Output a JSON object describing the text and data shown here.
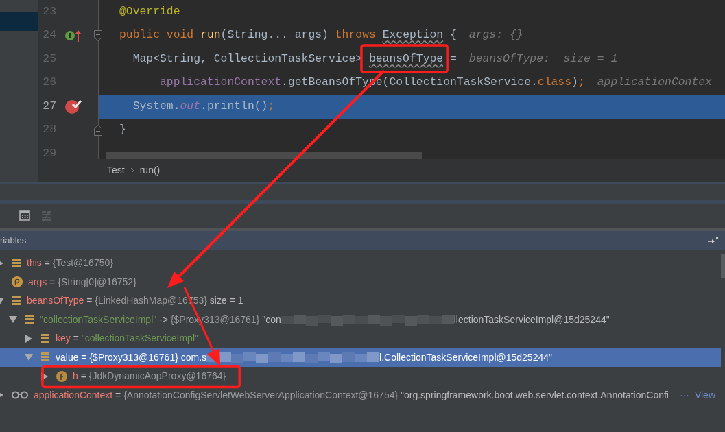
{
  "project_panel": {
    "items": [
      {
        "selected": true
      }
    ]
  },
  "editor": {
    "lines": [
      {
        "number": "23",
        "current": false,
        "tokens": [
          {
            "text": "@Override",
            "kind": "annotation"
          }
        ]
      },
      {
        "number": "24",
        "current": false,
        "marker": {
          "kind": "implements"
        },
        "fold": {
          "kind": "start"
        },
        "tokens": [
          {
            "text": "public void",
            "kind": "keyword"
          },
          {
            "text": " run",
            "kind": "method"
          },
          {
            "text": "(String... args) ",
            "kind": "plain"
          },
          {
            "text": "throws ",
            "kind": "keyword"
          },
          {
            "text": "Exception",
            "kind": "warning"
          },
          {
            "text": " {",
            "kind": "plain"
          }
        ],
        "hint": "args: {}"
      },
      {
        "number": "25",
        "current": false,
        "tokens": [
          {
            "text": "  Map<String, CollectionTaskService> ",
            "kind": "plain"
          },
          {
            "text": "beansOfType",
            "kind": "warning",
            "highlighted": true
          },
          {
            "text": " =",
            "kind": "plain"
          }
        ],
        "hint": "beansOfType:  size = 1"
      },
      {
        "number": "26",
        "current": false,
        "tokens": [
          {
            "text": "      applicationContext",
            "kind": "field"
          },
          {
            "text": ".getBeansOfType(CollectionTaskService.",
            "kind": "plain"
          },
          {
            "text": "class",
            "kind": "keyword"
          },
          {
            "text": ")",
            "kind": "plain"
          },
          {
            "text": ";",
            "kind": "keyword"
          }
        ],
        "hint": "applicationContex"
      },
      {
        "number": "27",
        "current": true,
        "marker": {
          "kind": "breakpoint"
        },
        "tokens": [
          {
            "text": "  System.",
            "kind": "plain"
          },
          {
            "text": "out",
            "kind": "static"
          },
          {
            "text": ".println()",
            "kind": "plain"
          },
          {
            "text": ";",
            "kind": "keyword"
          }
        ]
      },
      {
        "number": "28",
        "current": false,
        "fold": {
          "kind": "end"
        },
        "tokens": [
          {
            "text": "}",
            "kind": "plain"
          }
        ]
      },
      {
        "number": "29",
        "current": false
      }
    ]
  },
  "breadcrumbs": [
    "Test",
    "run()"
  ],
  "debug_toolbar": {
    "buttons": [
      {
        "kind": "table",
        "disabled": false
      },
      {
        "kind": "compact",
        "disabled": true
      }
    ]
  },
  "variables": {
    "title": "riables",
    "tree": [
      {
        "kind": "object",
        "name": "this",
        "expanded": false,
        "selected": false,
        "parts": [
          {
            "kind": "plain",
            "text": "="
          },
          {
            "kind": "ref",
            "text": "{Test@16750}"
          }
        ]
      },
      {
        "kind": "parameter",
        "name": "args",
        "selected": false,
        "parts": [
          {
            "kind": "plain",
            "text": "="
          },
          {
            "kind": "ref",
            "text": "{String[0]@16752}"
          }
        ]
      },
      {
        "kind": "object",
        "name": "beansOfType",
        "expanded": true,
        "selected": false,
        "parts": [
          {
            "kind": "plain",
            "text": "="
          },
          {
            "kind": "ref",
            "text": "{LinkedHashMap@16753}"
          },
          {
            "kind": "plain",
            "text": " size = 1"
          }
        ],
        "children": [
          {
            "kind": "entry",
            "name": "\"collectionTaskServiceImpl\"",
            "expanded": true,
            "selected": false,
            "parts": [
              {
                "kind": "plain",
                "text": "->"
              },
              {
                "kind": "ref",
                "text": "{$Proxy313@16761}"
              },
              {
                "kind": "plain",
                "text": "\"con"
              },
              {
                "kind": "redacted"
              },
              {
                "kind": "plain",
                "text": "llectionTaskServiceImpl@15d25244\""
              }
            ],
            "children": [
              {
                "kind": "object",
                "name": "key",
                "expanded": false,
                "selected": false,
                "parts": [
                  {
                    "kind": "plain",
                    "text": "="
                  },
                  {
                    "kind": "string",
                    "text": "\"collectionTaskServiceImpl\""
                  }
                ]
              },
              {
                "kind": "object",
                "name": "value",
                "expanded": true,
                "selected": true,
                "parts": [
                  {
                    "kind": "plain",
                    "text": "="
                  },
                  {
                    "kind": "ref",
                    "text": "{$Proxy313@16761}"
                  },
                  {
                    "kind": "plain",
                    "text": "com.s"
                  },
                  {
                    "kind": "redacted"
                  },
                  {
                    "kind": "plain",
                    "text": "l.CollectionTaskServiceImpl@15d25244\""
                  }
                ],
                "children": [
                  {
                    "kind": "field",
                    "name": "h",
                    "expanded": false,
                    "selected": false,
                    "highlighted": true,
                    "parts": [
                      {
                        "kind": "plain",
                        "text": "="
                      },
                      {
                        "kind": "ref",
                        "text": "{JdkDynamicAopProxy@16764}"
                      }
                    ]
                  }
                ]
              }
            ]
          }
        ]
      },
      {
        "kind": "watch",
        "name": "applicationContext",
        "expanded": false,
        "selected": false,
        "parts": [
          {
            "kind": "plain",
            "text": "="
          },
          {
            "kind": "ref",
            "text": "{AnnotationConfigServletWebServerApplicationContext@16754}"
          },
          {
            "kind": "plain",
            "text": "\"org.springframework.boot.web.servlet.context.AnnotationConfi"
          },
          {
            "kind": "ellipsis",
            "text": "···"
          },
          {
            "kind": "link",
            "text": "View"
          }
        ]
      }
    ]
  }
}
